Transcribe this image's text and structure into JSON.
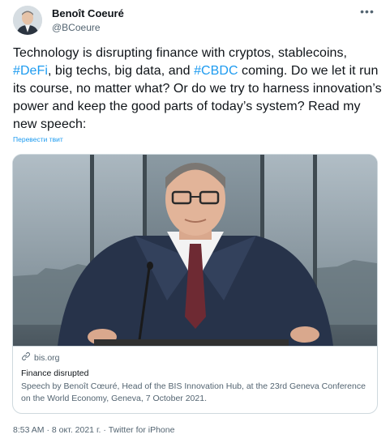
{
  "author": {
    "name": "Benoît Coeuré",
    "handle": "@BCoeure"
  },
  "more_icon": "more-dots-icon",
  "tweet": {
    "text_parts": [
      "Technology is disrupting finance with cryptos, stablecoins, ",
      "#DeFi",
      ", big techs, big data, and ",
      "#CBDC",
      " coming. Do we let it run its course, no matter what? Or do we try to harness innovation’s power and keep the good parts of today’s system? Read my new speech:"
    ],
    "translate_label": "Перевести твит"
  },
  "card": {
    "domain": "bis.org",
    "domain_icon": "link-icon",
    "title": "Finance disrupted",
    "description": "Speech by Benoît Cœuré, Head of the BIS Innovation Hub, at the 23rd Geneva Conference on the World Economy, Geneva, 7 October 2021."
  },
  "meta": {
    "time": "8:53 AM",
    "separator": " · ",
    "date": "8 окт. 2021 г.",
    "source": "Twitter for iPhone"
  },
  "colors": {
    "link": "#1d9bf0",
    "text": "#0f1419",
    "secondary": "#536471",
    "border": "#cfd9de"
  }
}
